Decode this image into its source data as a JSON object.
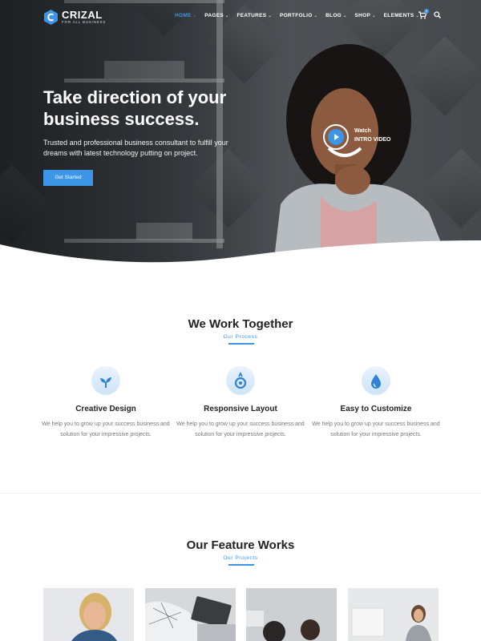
{
  "nav": {
    "logo": "CRIZAL",
    "tagline": "FOR ALL BUSINESS",
    "items": [
      {
        "label": "HOME",
        "active": true
      },
      {
        "label": "PAGES"
      },
      {
        "label": "FEATURES"
      },
      {
        "label": "PORTFOLIO"
      },
      {
        "label": "BLOG"
      },
      {
        "label": "SHOP"
      },
      {
        "label": "ELEMENTS"
      }
    ],
    "cart_count": "0",
    "icons": [
      "cart-icon",
      "search-icon"
    ]
  },
  "hero": {
    "title": "Take direction of your business success.",
    "subtitle": "Trusted and professional business consultant to fulfill your dreams with latest technology putting on project.",
    "button": "Get Started",
    "watch_line1": "Watch",
    "watch_line2": "INTRO VIDEO"
  },
  "process": {
    "title": "We Work Together",
    "subtitle": "Our Process",
    "features": [
      {
        "icon": "leaf-icon",
        "title": "Creative Design",
        "desc": "We help you to grow up your success business and solution for your impressive projects."
      },
      {
        "icon": "responsive-icon",
        "title": "Responsive Layout",
        "desc": "We help you to grow up your success business and solution for your impressive projects."
      },
      {
        "icon": "drop-icon",
        "title": "Easy to Customize",
        "desc": "We help you to grow up your success business and solution for your impressive projects."
      }
    ]
  },
  "works": {
    "title": "Our Feature Works",
    "subtitle": "Our Projects"
  },
  "colors": {
    "accent": "#3d95e8",
    "dark": "#222222",
    "muted": "#777777"
  }
}
